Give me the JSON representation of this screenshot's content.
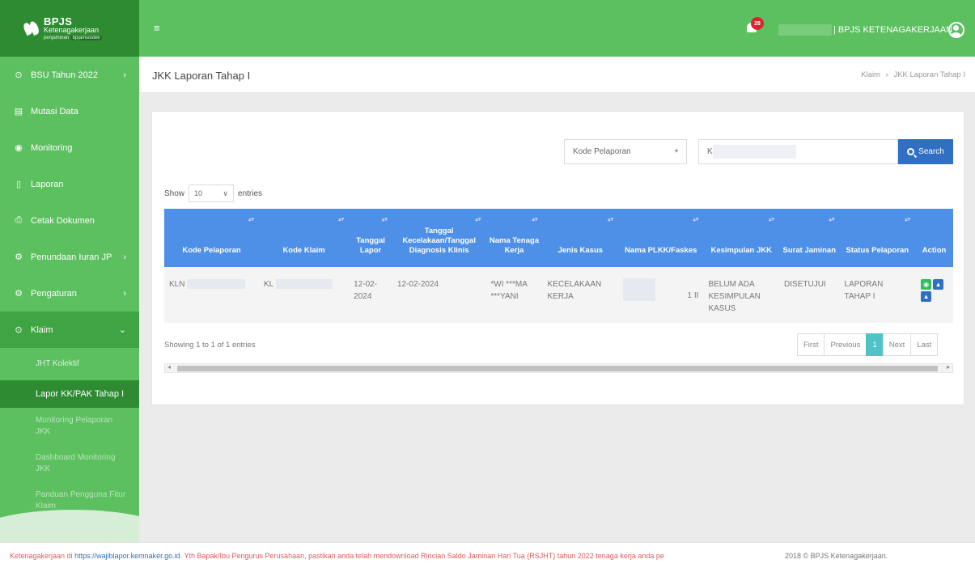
{
  "brand": {
    "name": "BPJS",
    "sub": "Ketenagakerjaan",
    "tag_prefix": "penjaminan",
    "tag": "bpjamsostek"
  },
  "sidebar": {
    "items": [
      {
        "label": "BSU Tahun 2022",
        "icon": "check-circle-icon",
        "glyph": "⊙",
        "chevron": "›"
      },
      {
        "label": "Mutasi Data",
        "icon": "document-icon",
        "glyph": "▤",
        "chevron": ""
      },
      {
        "label": "Monitoring",
        "icon": "eye-icon",
        "glyph": "◉",
        "chevron": ""
      },
      {
        "label": "Laporan",
        "icon": "report-icon",
        "glyph": "▯",
        "chevron": ""
      },
      {
        "label": "Cetak Dokumen",
        "icon": "print-icon",
        "glyph": "⎙",
        "chevron": ""
      },
      {
        "label": "Penundaan Iuran JP",
        "icon": "gear-icon",
        "glyph": "⚙",
        "chevron": "›"
      },
      {
        "label": "Pengaturan",
        "icon": "settings-icon",
        "glyph": "⚙",
        "chevron": "›"
      },
      {
        "label": "Klaim",
        "icon": "check-circle-icon",
        "glyph": "⊙",
        "chevron": "⌄"
      }
    ],
    "sub_items": [
      {
        "label": "JHT Kolektif"
      },
      {
        "label": "Lapor KK/PAK Tahap I"
      },
      {
        "label": "Monitoring Pelaporan JKK"
      },
      {
        "label": "Dashboard Monitoring JKK"
      },
      {
        "label": "Panduan Pengguna Fitur Klaim"
      }
    ]
  },
  "header": {
    "menu_glyph": "≡",
    "notification_count": "28",
    "user_name": "| BPJS KETENAGAKERJAAN"
  },
  "page": {
    "title": "JKK Laporan Tahap I",
    "breadcrumb": [
      "Klaim",
      "JKK Laporan Tahap I"
    ],
    "breadcrumb_sep": "›"
  },
  "filter": {
    "select_value": "Kode Pelaporan",
    "select_caret": "▾",
    "search_value": "KLN",
    "search_button": "Search"
  },
  "length": {
    "show": "Show",
    "value": "10",
    "caret": "∨",
    "entries": "entries"
  },
  "table": {
    "sort_glyph": "▴▾",
    "columns": [
      "Kode Pelaporan",
      "Kode Klaim",
      "Tanggal Lapor",
      "Tanggal Kecelakaan/Tanggal Diagnosis Klinis",
      "Nama Tenaga Kerja",
      "Jenis Kasus",
      "Nama PLKK/Faskes",
      "Kesimpulan JKK",
      "Surat Jaminan",
      "Status Pelaporan",
      "Action"
    ],
    "rows": [
      {
        "kode_pelaporan": "KLN",
        "kode_klaim": "KL",
        "tanggal_lapor": "12-02-2024",
        "tanggal_kecelakaan": "12-02-2024",
        "nama_tenaga_kerja": "*WI ***MA ***YANI",
        "jenis_kasus": "KECELAKAAN KERJA",
        "nama_plkk": "1 II",
        "kesimpulan": "BELUM ADA KESIMPULAN KASUS",
        "surat_jaminan": "DISETUJUI",
        "status": "LAPORAN TAHAP I"
      }
    ]
  },
  "actions": {
    "view_glyph": "◉",
    "print_glyph": "▲"
  },
  "pagination": {
    "info": "Showing 1 to 1 of 1 entries",
    "first": "First",
    "previous": "Previous",
    "current": "1",
    "next": "Next",
    "last": "Last"
  },
  "scroll": {
    "left": "◂",
    "right": "▸"
  },
  "footer": {
    "marquee_prefix": "Ketenagakerjaan di ",
    "marquee_link": "https://wajiblapor.kemnaker.go.id",
    "marquee_suffix": ". Yth Bapak/Ibu Pengurus Perusahaan, pastikan anda telah mendownload Rincian Saldo Jaminan Hari Tua (RSJHT) tahun 2022 tenaga kerja anda pe",
    "copyright": "2018 © BPJS Ketenagakerjaan."
  }
}
